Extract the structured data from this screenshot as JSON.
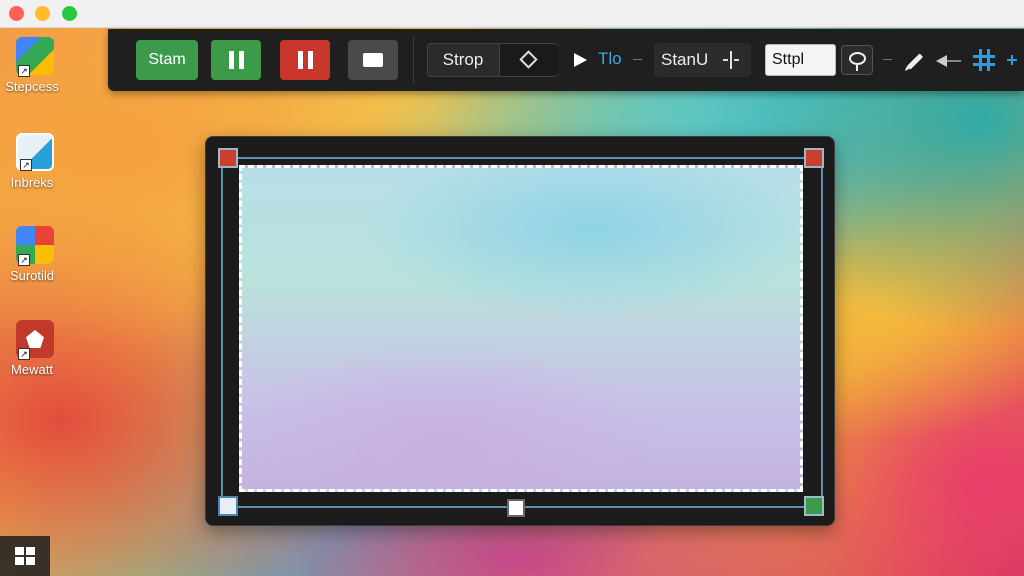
{
  "desktop": {
    "icons": [
      {
        "label": "Stepcess"
      },
      {
        "label": "Inbreks"
      },
      {
        "label": "Surotild"
      },
      {
        "label": "Mewatt"
      }
    ]
  },
  "toolbar": {
    "start_label": "Stam",
    "mode_label": "Strop",
    "timer_label": "Tlo",
    "step_label": "StanU",
    "field_value": "Sttpl"
  },
  "colors": {
    "start": "#3b9a4b",
    "pause": "#3d9a48",
    "record_stop": "#c9372c",
    "accent_blue": "#2f9be0",
    "handle_red": "#c9412e",
    "handle_green": "#3a9a48"
  }
}
